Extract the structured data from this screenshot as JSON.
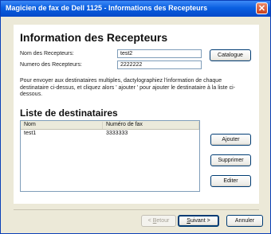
{
  "window": {
    "title": "Magicien de fax de Dell 1125 - Informations des Recepteurs",
    "close_glyph": "✕"
  },
  "form": {
    "heading": "Information des Recepteurs",
    "name_label": "Nom des Recepteurs:",
    "name_value": "test2",
    "number_label": "Numero des Recepteurs:",
    "number_value": "2222222",
    "catalog_button": "Catalogue",
    "help_text": "Pour envoyer aux destinataires multiples, dactylographiez l'information de chaque destinataire ci-dessus, et cliquez alors ' ajouter ' pour ajouter le destinataire à la liste ci-dessous."
  },
  "list": {
    "title": "Liste de destinataires",
    "columns": [
      "Nom",
      "Numéro de fax"
    ],
    "rows": [
      {
        "name": "test1",
        "fax": "3333333"
      }
    ],
    "buttons": {
      "add": "Ajouter",
      "delete": "Supprimer",
      "edit": "Editer"
    }
  },
  "nav": {
    "back": {
      "prefix": "< ",
      "mnemonic": "B",
      "rest": "etour"
    },
    "next": {
      "mnemonic": "S",
      "rest": "uivant",
      "suffix": " >"
    },
    "cancel": "Annuler"
  },
  "colors": {
    "title_bar": "#0a5fe0",
    "dialog_bg": "#ece9d8",
    "panel_bg": "#ffffff"
  }
}
